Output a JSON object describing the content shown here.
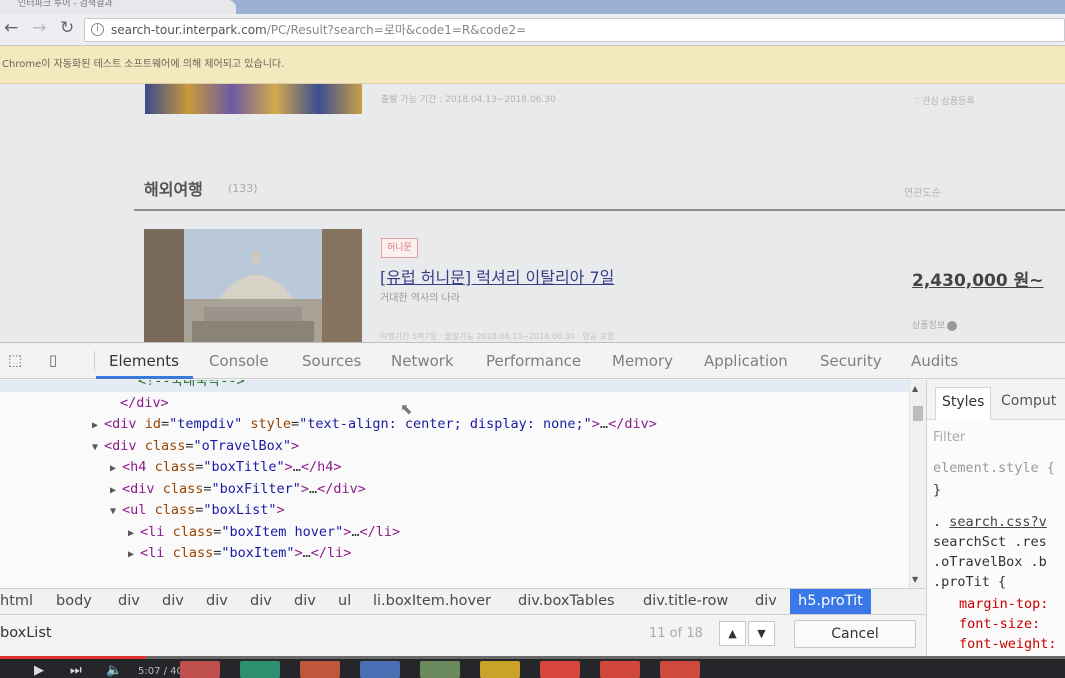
{
  "browser": {
    "tab_title": "인터파크 투어 - 검색결과",
    "back_icon": "arrow-left-icon",
    "forward_icon": "arrow-right-icon",
    "reload_icon": "reload-icon",
    "url_host": "search-tour.interpark.com",
    "url_path": "/PC/Result?search=로마&code1=R&code2=",
    "infobar_text": "Chrome이 자동화된 테스트 소프트웨어에 의해 제어되고 있습니다."
  },
  "page": {
    "top_item": {
      "subtitle": "출발 가능 기간 : 2018.04.13~2018.06.30",
      "right_heart": "♡",
      "right_text": "관심 상품등록"
    },
    "section": {
      "title": "해외여행",
      "count": "(133)",
      "sort": "연관도순"
    },
    "tour": {
      "badge": "허니문",
      "title": "[유럽 허니문] 럭셔리 이탈리아 7일",
      "subtitle": "거대한 역사의 나라",
      "price": "2,430,000 원~",
      "right_text": "상품정보",
      "meta": "여행기간 5박7일 · 출발가능 2018.04.13~2018.06.30 · 항공 포함"
    }
  },
  "devtools": {
    "tabs": [
      "Elements",
      "Console",
      "Sources",
      "Network",
      "Performance",
      "Memory",
      "Application",
      "Security",
      "Audits"
    ],
    "active_tab": "Elements",
    "dom_lines": [
      {
        "tri": "",
        "html": [
          [
            "cmt",
            "<!--국내숙박-->"
          ]
        ]
      },
      {
        "tri": "",
        "html": [
          [
            "tag",
            "</div>"
          ]
        ]
      },
      {
        "tri": "▶",
        "html": [
          [
            "tag",
            "<div "
          ],
          [
            "attr",
            "id"
          ],
          [
            "txt",
            "="
          ],
          [
            "val",
            "\"tempdiv\""
          ],
          [
            "txt",
            " "
          ],
          [
            "attr",
            "style"
          ],
          [
            "txt",
            "="
          ],
          [
            "val",
            "\"text-align: center; display: none;\""
          ],
          [
            "tag",
            ">"
          ],
          [
            "txt",
            "…"
          ],
          [
            "tag",
            "</div>"
          ]
        ]
      },
      {
        "tri": "▼",
        "html": [
          [
            "tag",
            "<div "
          ],
          [
            "attr",
            "class"
          ],
          [
            "txt",
            "="
          ],
          [
            "val",
            "\"oTravelBox\""
          ],
          [
            "tag",
            ">"
          ]
        ]
      },
      {
        "tri": "▶",
        "html": [
          [
            "tag",
            "<h4 "
          ],
          [
            "attr",
            "class"
          ],
          [
            "txt",
            "="
          ],
          [
            "val",
            "\"boxTitle\""
          ],
          [
            "tag",
            ">"
          ],
          [
            "txt",
            "…"
          ],
          [
            "tag",
            "</h4>"
          ]
        ]
      },
      {
        "tri": "▶",
        "html": [
          [
            "tag",
            "<div "
          ],
          [
            "attr",
            "class"
          ],
          [
            "txt",
            "="
          ],
          [
            "val",
            "\"boxFilter\""
          ],
          [
            "tag",
            ">"
          ],
          [
            "txt",
            "…"
          ],
          [
            "tag",
            "</div>"
          ]
        ]
      },
      {
        "tri": "▼",
        "html": [
          [
            "tag",
            "<ul "
          ],
          [
            "attr",
            "class"
          ],
          [
            "txt",
            "="
          ],
          [
            "val",
            "\"boxList\""
          ],
          [
            "tag",
            ">"
          ]
        ]
      },
      {
        "tri": "▶",
        "html": [
          [
            "tag",
            "<li "
          ],
          [
            "attr",
            "class"
          ],
          [
            "txt",
            "="
          ],
          [
            "val",
            "\"boxItem hover\""
          ],
          [
            "tag",
            ">"
          ],
          [
            "txt",
            "…"
          ],
          [
            "tag",
            "</li>"
          ]
        ]
      },
      {
        "tri": "▶",
        "html": [
          [
            "tag",
            "<li "
          ],
          [
            "attr",
            "class"
          ],
          [
            "txt",
            "="
          ],
          [
            "val",
            "\"boxItem\""
          ],
          [
            "tag",
            ">"
          ],
          [
            "txt",
            "…"
          ],
          [
            "tag",
            "</li>"
          ]
        ]
      }
    ],
    "styles_tabs": [
      "Styles",
      "Comput"
    ],
    "styles": {
      "filter_placeholder": "Filter",
      "element_style": "element.style {",
      "close_brace": "}",
      "rule_source": "search.css?v",
      "selector_1": "searchSct .res",
      "selector_2": ".oTravelBox .b",
      "selector_3": ".proTit {",
      "props": [
        "margin-top:",
        "font-size:",
        "font-weight:"
      ]
    },
    "breadcrumbs": [
      "html",
      "body",
      "div",
      "div",
      "div",
      "div",
      "div",
      "ul",
      "li.boxItem.hover",
      "div.boxTables",
      "div.title-row",
      "div",
      "h5.proTit"
    ],
    "search": {
      "query": "boxList",
      "count": "11 of 18",
      "up_icon": "chevron-up-icon",
      "down_icon": "chevron-down-icon",
      "cancel_label": "Cancel"
    }
  },
  "player": {
    "progress": 0.137,
    "time": "5:07 / 40:41",
    "accent": "#e03030"
  }
}
